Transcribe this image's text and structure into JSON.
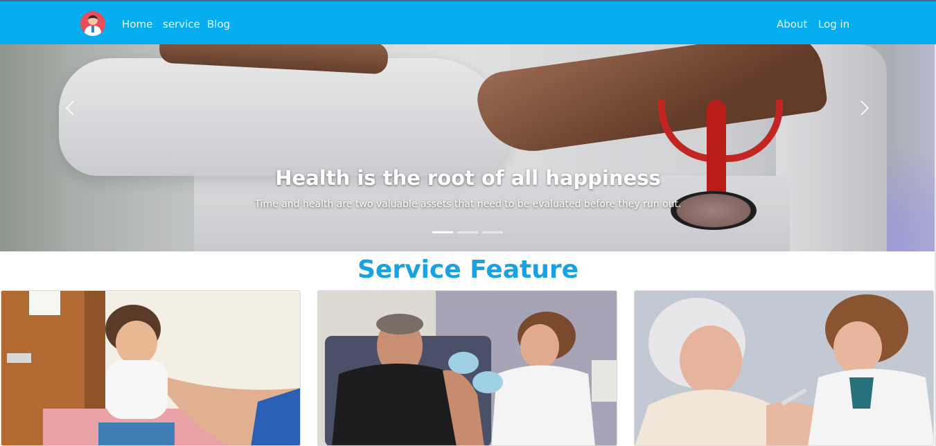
{
  "navbar": {
    "brand_icon": "doctor-avatar-icon",
    "left_links": [
      "Home",
      "service",
      "Blog"
    ],
    "right_links": [
      "About",
      "Log in"
    ],
    "background_color": "#06aeef"
  },
  "hero": {
    "title": "Health is the root of all happiness",
    "subtitle": "Time and health are two valuable assets that need to be evaluated before they run out.",
    "prev_icon": "chevron-left-icon",
    "next_icon": "chevron-right-icon",
    "slide_count": 3,
    "active_slide": 1
  },
  "services": {
    "title": "Service Feature",
    "title_color": "#17a2e2",
    "cards": [
      {
        "image": "child-vaccination-photo"
      },
      {
        "image": "man-vaccination-photo"
      },
      {
        "image": "elderly-woman-vaccination-photo"
      }
    ]
  }
}
